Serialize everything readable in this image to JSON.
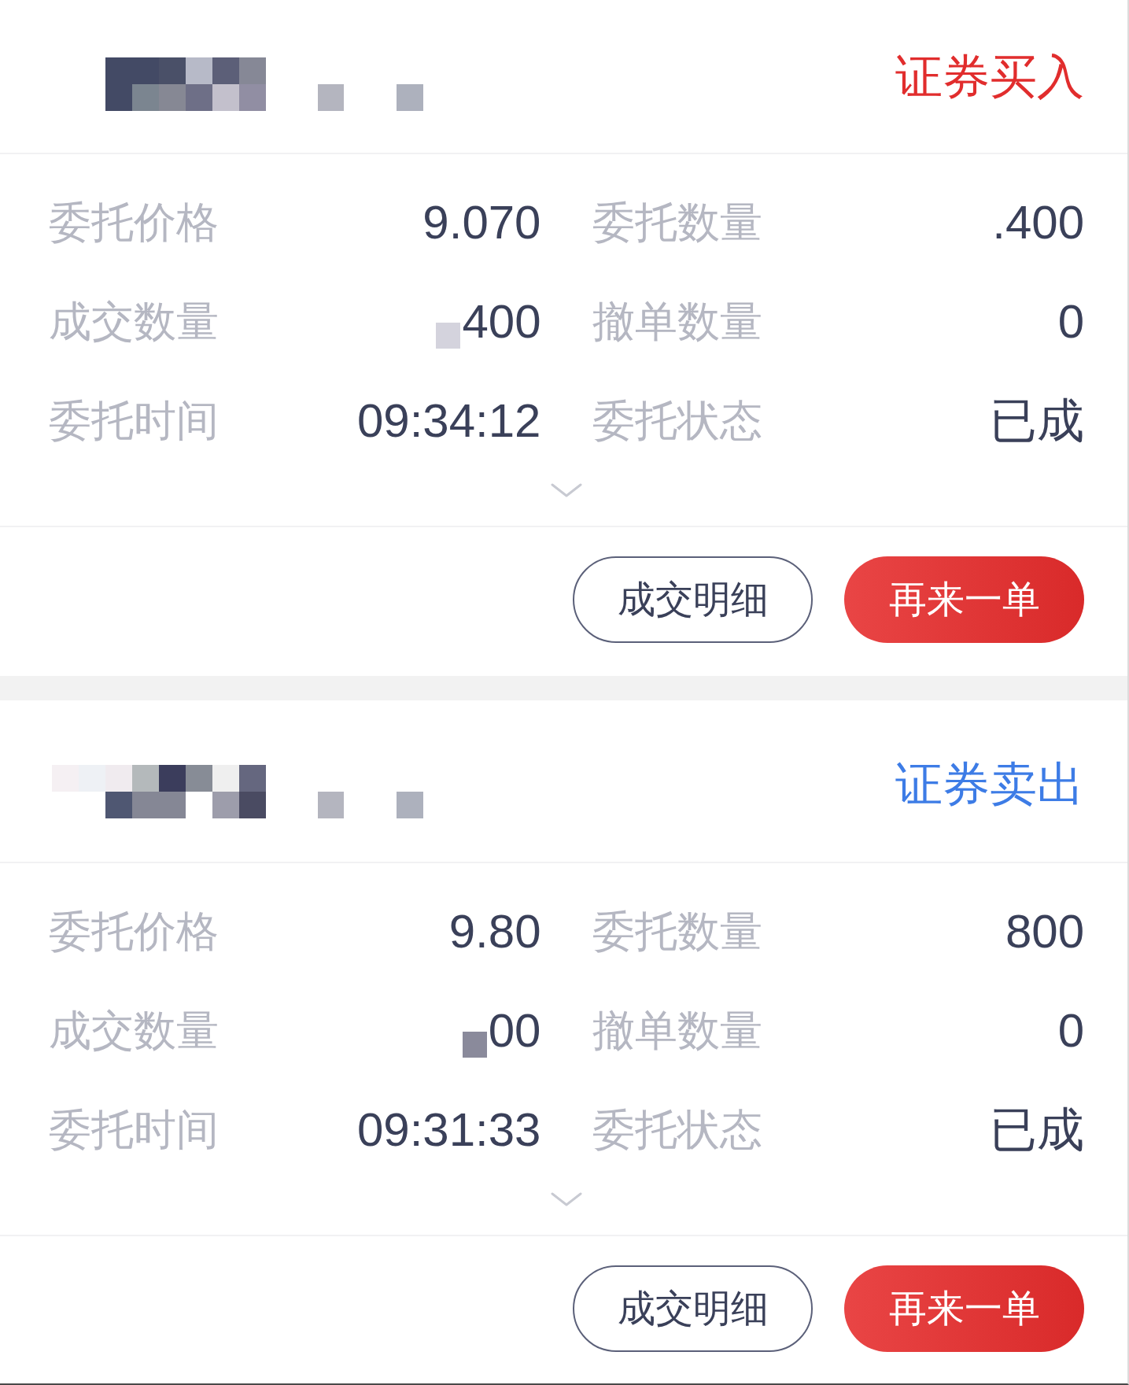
{
  "orders": [
    {
      "title": "证券买入",
      "color": "#e12d2d",
      "fields": [
        {
          "label": "委托价格",
          "value": "9.070",
          "redacted": false
        },
        {
          "label": "委托数量",
          "value": ".400",
          "redacted": false
        },
        {
          "label": "成交数量",
          "value": "400",
          "redacted": true
        },
        {
          "label": "撤单数量",
          "value": "0",
          "redacted": false
        },
        {
          "label": "委托时间",
          "value": "09:34:12",
          "redacted": false
        },
        {
          "label": "委托状态",
          "value": "已成",
          "redacted": false
        }
      ],
      "buttons": [
        {
          "label": "成交明细",
          "kind": "outline"
        },
        {
          "label": "再来一单",
          "kind": "primary"
        }
      ]
    },
    {
      "title": "证券卖出",
      "color": "#3d7ce6",
      "fields": [
        {
          "label": "委托价格",
          "value": "9.80",
          "redacted": false
        },
        {
          "label": "委托数量",
          "value": "800",
          "redacted": false
        },
        {
          "label": "成交数量",
          "value": "00",
          "redacted": true
        },
        {
          "label": "撤单数量",
          "value": "0",
          "redacted": false
        },
        {
          "label": "委托时间",
          "value": "09:31:33",
          "redacted": false
        },
        {
          "label": "委托状态",
          "value": "已成",
          "redacted": false
        }
      ],
      "buttons": [
        {
          "label": "成交明细",
          "kind": "outline"
        },
        {
          "label": "再来一单",
          "kind": "primary"
        }
      ]
    }
  ]
}
